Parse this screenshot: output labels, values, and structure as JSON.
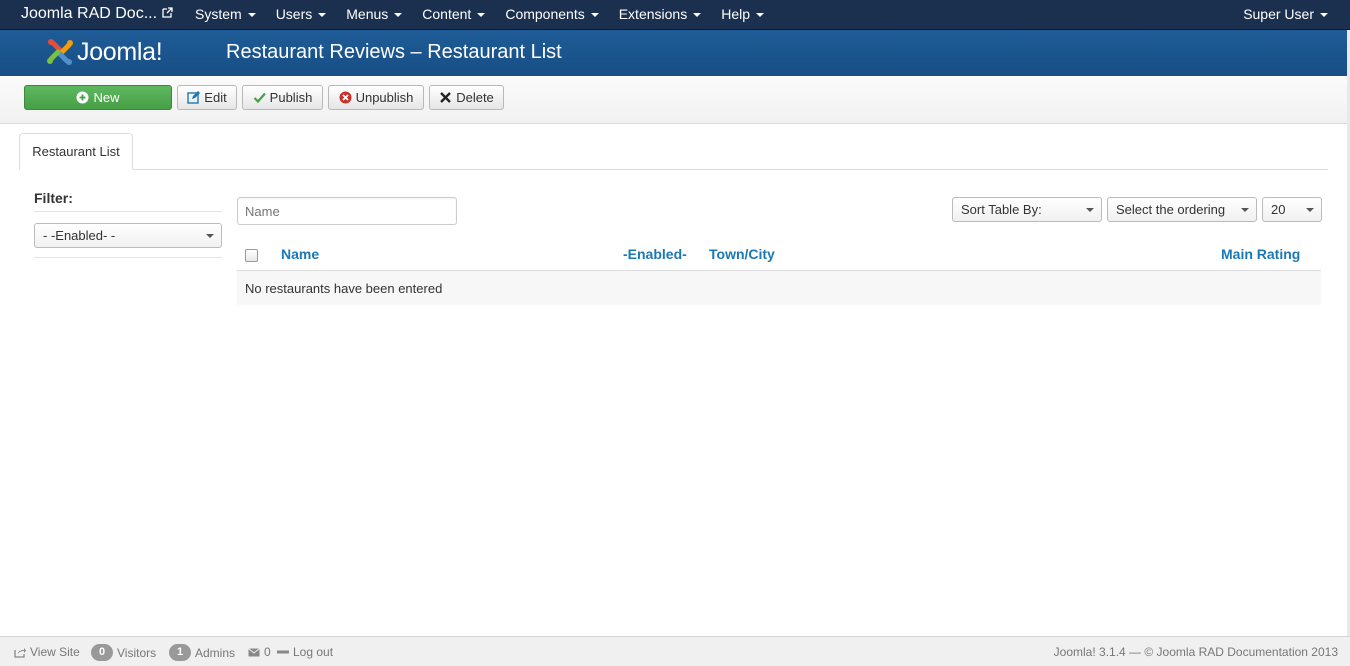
{
  "navbar": {
    "brand": "Joomla RAD Doc...",
    "menu": [
      {
        "label": "System"
      },
      {
        "label": "Users"
      },
      {
        "label": "Menus"
      },
      {
        "label": "Content"
      },
      {
        "label": "Components"
      },
      {
        "label": "Extensions"
      },
      {
        "label": "Help"
      }
    ],
    "user": "Super User"
  },
  "header": {
    "logo_text": "Joomla!",
    "title": "Restaurant Reviews – Restaurant List"
  },
  "toolbar": {
    "new_label": "New",
    "edit_label": "Edit",
    "publish_label": "Publish",
    "unpublish_label": "Unpublish",
    "delete_label": "Delete"
  },
  "tabs": [
    {
      "label": "Restaurant List",
      "active": true
    }
  ],
  "sidebar": {
    "filter_label": "Filter:",
    "enabled_select": "- -Enabled- -"
  },
  "search": {
    "placeholder": "Name",
    "value": ""
  },
  "list_controls": {
    "sort_select": "Sort Table By:",
    "ordering_select": "Select the ordering",
    "limit_select": "20"
  },
  "table": {
    "columns": [
      "Name",
      "-Enabled-",
      "Town/City",
      "Main Rating"
    ],
    "empty_message": "No restaurants have been entered"
  },
  "footer": {
    "view_site": "View Site",
    "visitors_count": "0",
    "visitors_label": "Visitors",
    "admins_count": "1",
    "admins_label": "Admins",
    "messages_count": "0",
    "logout": "Log out",
    "copyright": "Joomla! 3.1.4 — © Joomla RAD Documentation 2013"
  },
  "colors": {
    "navbar_bg": "#1b2f4e",
    "header_bg": "#1f5c97",
    "new_button": "#46a046",
    "link_blue": "#1c78b4"
  }
}
